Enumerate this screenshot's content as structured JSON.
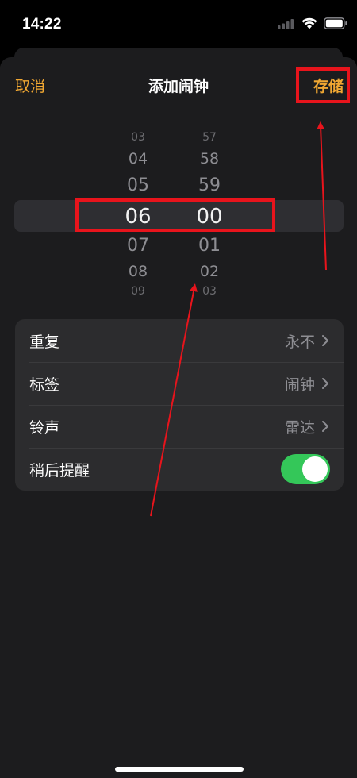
{
  "status_bar": {
    "time": "14:22",
    "icons": [
      "signal-icon",
      "wifi-icon",
      "battery-icon"
    ]
  },
  "nav": {
    "cancel_label": "取消",
    "title": "添加闹钟",
    "save_label": "存储"
  },
  "picker": {
    "hours": [
      "03",
      "04",
      "05",
      "06",
      "07",
      "08",
      "09"
    ],
    "minutes": [
      "57",
      "58",
      "59",
      "00",
      "01",
      "02",
      "03"
    ],
    "selected_hour": "06",
    "selected_minute": "00"
  },
  "settings": {
    "repeat": {
      "label": "重复",
      "value": "永不"
    },
    "label": {
      "label": "标签",
      "value": "闹钟"
    },
    "sound": {
      "label": "铃声",
      "value": "雷达"
    },
    "snooze": {
      "label": "稍后提醒",
      "enabled": true
    }
  },
  "colors": {
    "accent": "#f0a732",
    "toggle_on": "#34c759",
    "annotation": "#e8141c",
    "sheet_bg": "#1c1c1e",
    "cell_bg": "#2c2c2e"
  }
}
